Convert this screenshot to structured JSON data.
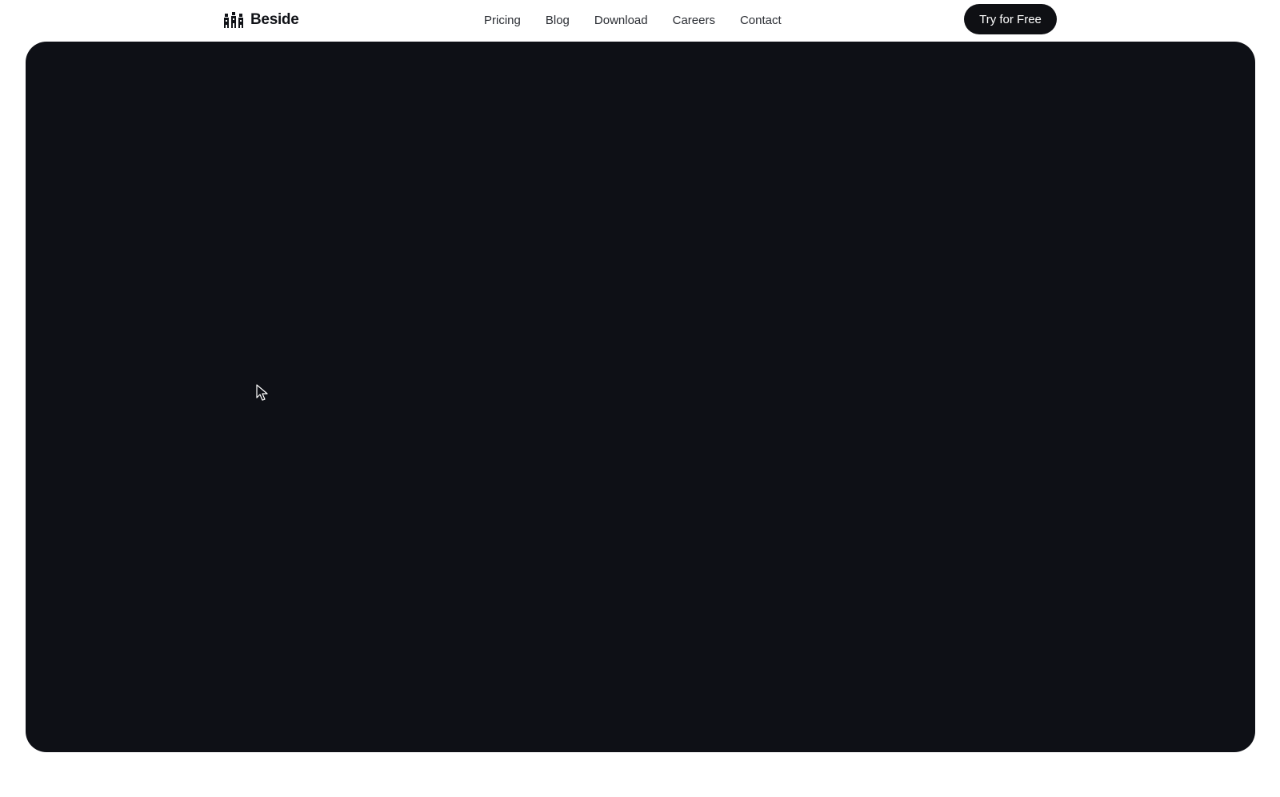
{
  "header": {
    "brand": {
      "name": "Beside",
      "icon": "people-group-logo-icon"
    },
    "nav": [
      {
        "label": "Pricing"
      },
      {
        "label": "Blog"
      },
      {
        "label": "Download"
      },
      {
        "label": "Careers"
      },
      {
        "label": "Contact"
      }
    ],
    "cta_label": "Try for Free"
  },
  "hero": {
    "background_color": "#0e1016"
  },
  "colors": {
    "page_background": "#ffffff",
    "text": "#111318",
    "cta_background": "#0f1014",
    "cta_text": "#ffffff"
  },
  "cursor": {
    "icon": "mouse-pointer-icon"
  }
}
